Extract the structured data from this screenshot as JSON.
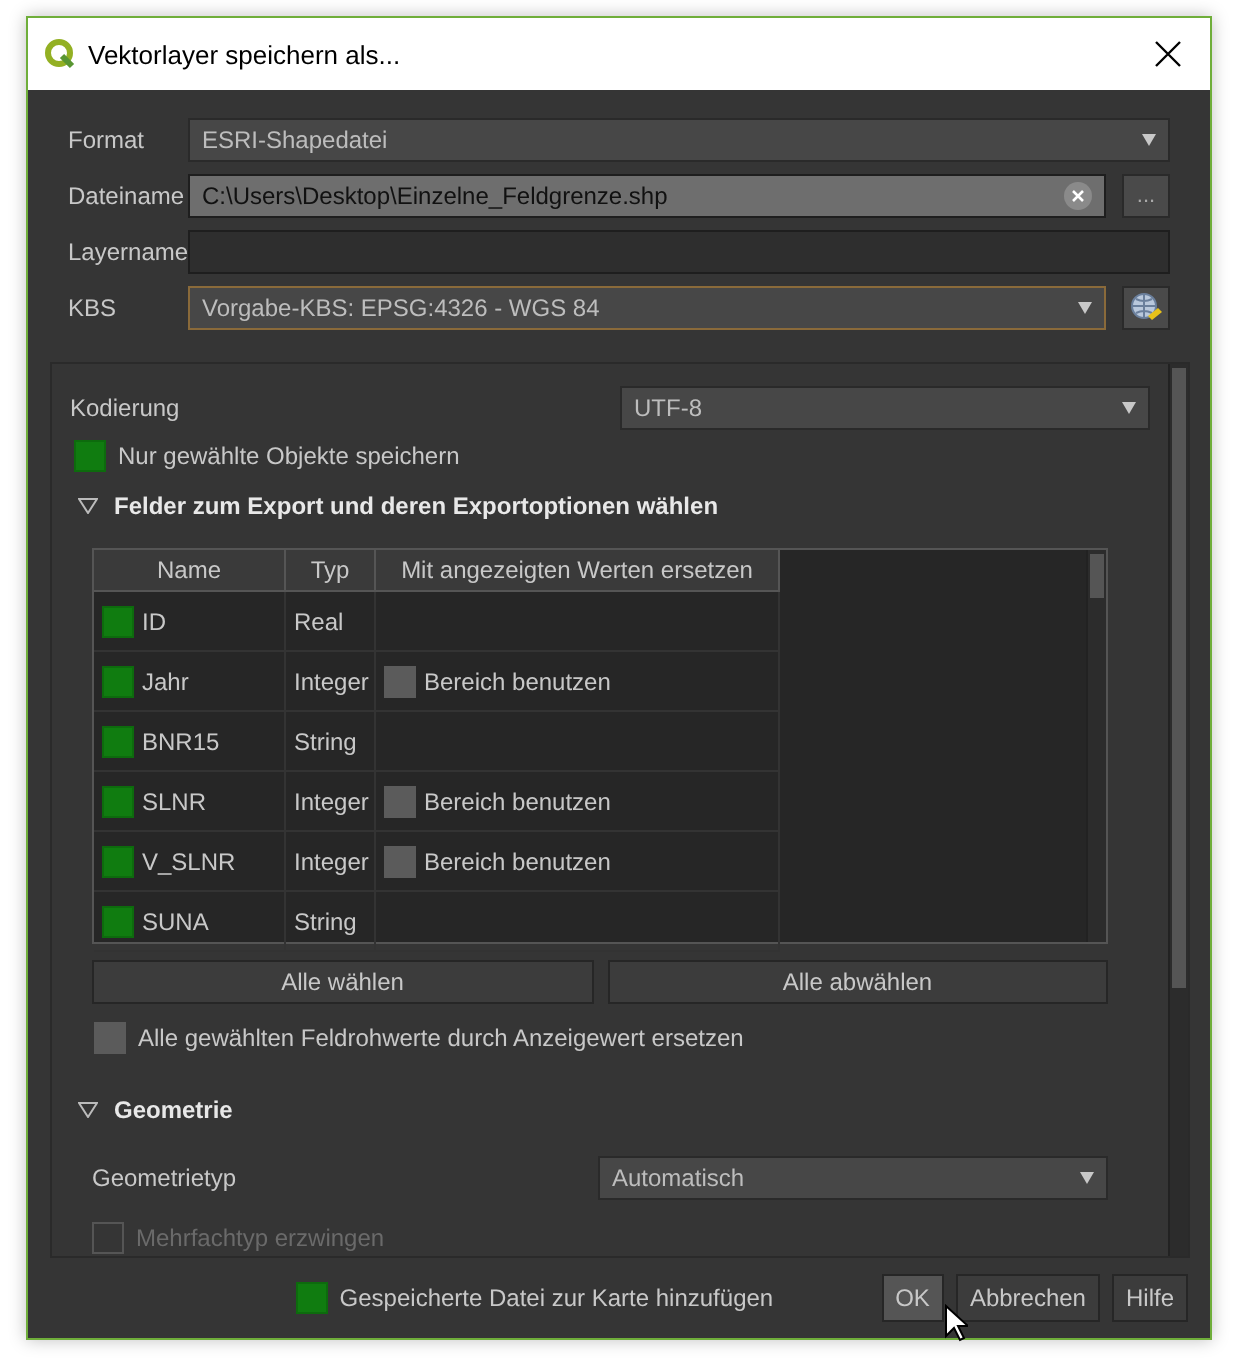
{
  "window": {
    "title": "Vektorlayer speichern als..."
  },
  "form": [
    {
      "label": "Format",
      "kind": "combo",
      "value": "ESRI-Shapedatei"
    },
    {
      "label": "Dateiname",
      "kind": "file",
      "value": "C:\\Users\\Desktop\\Einzelne_Feldgrenze.shp",
      "browse": "..."
    },
    {
      "label": "Layername",
      "kind": "text"
    },
    {
      "label": "KBS",
      "kind": "crs",
      "value": "Vorgabe-KBS: EPSG:4326 - WGS 84"
    }
  ],
  "encoding": {
    "label": "Kodierung",
    "value": "UTF-8"
  },
  "selected_only": {
    "label": "Nur gewählte Objekte speichern",
    "checked": true
  },
  "fields_section": {
    "title": "Felder zum Export und deren Exportoptionen wählen",
    "expanded": true
  },
  "table": {
    "columns": [
      "Name",
      "Typ",
      "Mit angezeigten Werten ersetzen"
    ],
    "rows": [
      {
        "name": "ID",
        "checked": true,
        "type": "Real"
      },
      {
        "name": "Jahr",
        "checked": true,
        "type": "Integer",
        "replace": {
          "label": "Bereich benutzen",
          "checked": false
        }
      },
      {
        "name": "BNR15",
        "checked": true,
        "type": "String"
      },
      {
        "name": "SLNR",
        "checked": true,
        "type": "Integer",
        "replace": {
          "label": "Bereich benutzen",
          "checked": false
        }
      },
      {
        "name": "V_SLNR",
        "checked": true,
        "type": "Integer",
        "replace": {
          "label": "Bereich benutzen",
          "checked": false
        }
      },
      {
        "name": "SUNA",
        "checked": true,
        "type": "String"
      }
    ]
  },
  "table_buttons": [
    "Alle wählen",
    "Alle abwählen"
  ],
  "replace_all": {
    "label": "Alle gewählten Feldrohwerte durch Anzeigewert ersetzen",
    "checked": false
  },
  "geometry_section": {
    "title": "Geometrie",
    "expanded": true
  },
  "geometry_type": {
    "label": "Geometrietyp",
    "value": "Automatisch"
  },
  "force_multi": {
    "label": "Mehrfachtyp erzwingen",
    "checked": false,
    "disabled": true
  },
  "add_to_map": {
    "label": "Gespeicherte Datei zur Karte hinzufügen",
    "checked": true
  },
  "buttons": [
    "OK",
    "Abbrechen",
    "Hilfe"
  ]
}
